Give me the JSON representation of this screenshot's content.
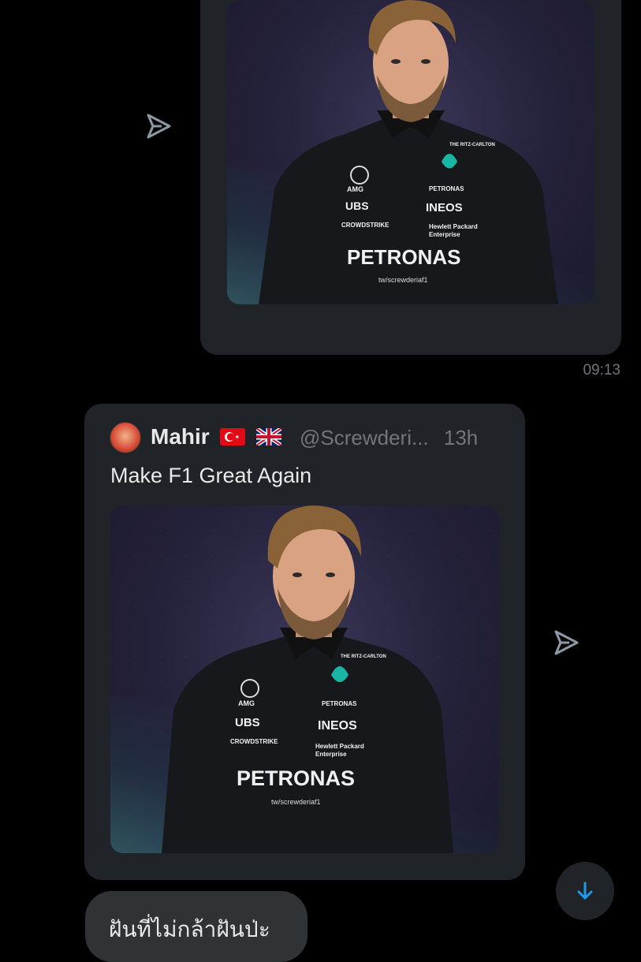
{
  "messages": [
    {
      "type": "shared_image",
      "image_watermark": "tw/screwderiaf1",
      "timestamp": "09:13"
    },
    {
      "type": "shared_tweet",
      "author": {
        "name": "Mahir",
        "flags": [
          "🇹🇷",
          "🇬🇧"
        ],
        "handle": "@Screwderi...",
        "time_ago": "13h"
      },
      "text": "Make F1 Great Again",
      "image_watermark": "tw/screwderiaf1"
    },
    {
      "type": "text",
      "text": "ฝันที่ไม่กล้าฝันป่ะ"
    }
  ],
  "suit_logos": [
    "PETRONAS",
    "UBS",
    "INEOS",
    "CROWDSTRIKE",
    "Hewlett Packard Enterprise",
    "AMG",
    "THE RITZ-CARLTON"
  ],
  "icons": {
    "share": "share-arrow-icon",
    "scroll": "arrow-down-icon"
  },
  "colors": {
    "accent": "#1d9bf0",
    "card_bg": "#202327",
    "muted": "#71767b"
  }
}
